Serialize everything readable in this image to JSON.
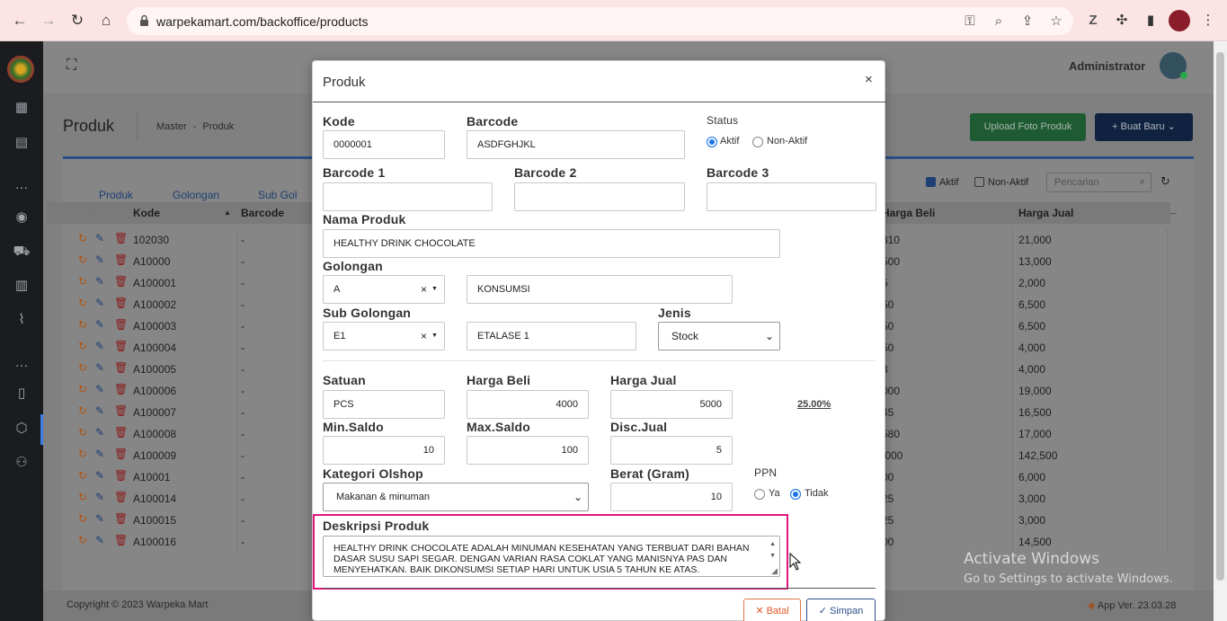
{
  "browser": {
    "url": "warpekamart.com/backoffice/products"
  },
  "topbar": {
    "user": "Administrator"
  },
  "page": {
    "title": "Produk",
    "breadcrumb": [
      "Master",
      "Produk"
    ],
    "buttons": {
      "upload": "Upload Foto Produk",
      "create": "+ Buat Baru"
    },
    "tabs": [
      "Produk",
      "Golongan",
      "Sub Gol"
    ],
    "filters": {
      "aktif": "Aktif",
      "nonaktif": "Non-Aktif",
      "search_placeholder": "Pencarian"
    }
  },
  "table": {
    "headers": [
      "Kode",
      "Barcode",
      "Harga Beli",
      "Harga Jual"
    ],
    "rows": [
      {
        "kode": "102030",
        "barcode": "-",
        "beli": "310",
        "jual": "21,000"
      },
      {
        "kode": "A10000",
        "barcode": "-",
        "beli": "500",
        "jual": "13,000"
      },
      {
        "kode": "A100001",
        "barcode": "-",
        "beli": "5",
        "jual": "2,000"
      },
      {
        "kode": "A100002",
        "barcode": "-",
        "beli": "50",
        "jual": "6,500"
      },
      {
        "kode": "A100003",
        "barcode": "-",
        "beli": "50",
        "jual": "6,500"
      },
      {
        "kode": "A100004",
        "barcode": "-",
        "beli": "50",
        "jual": "4,000"
      },
      {
        "kode": "A100005",
        "barcode": "-",
        "beli": "3",
        "jual": "4,000"
      },
      {
        "kode": "A100006",
        "barcode": "-",
        "beli": "000",
        "jual": "19,000"
      },
      {
        "kode": "A100007",
        "barcode": "-",
        "beli": "45",
        "jual": "16,500"
      },
      {
        "kode": "A100008",
        "barcode": "-",
        "beli": "580",
        "jual": "17,000"
      },
      {
        "kode": "A100009",
        "barcode": "-",
        "beli": ",000",
        "jual": "142,500"
      },
      {
        "kode": "A10001",
        "barcode": "-",
        "beli": "00",
        "jual": "6,000"
      },
      {
        "kode": "A100014",
        "barcode": "-",
        "beli": "25",
        "jual": "3,000"
      },
      {
        "kode": "A100015",
        "barcode": "-",
        "beli": "25",
        "jual": "3,000"
      },
      {
        "kode": "A100016",
        "barcode": "-",
        "beli": "00",
        "jual": "14,500"
      }
    ]
  },
  "footer": {
    "copyright": "Copyright © 2023 Warpeka Mart",
    "version": "App Ver. 23.03.28"
  },
  "modal": {
    "title": "Produk",
    "close": "×",
    "kode": {
      "label": "Kode",
      "value": "0000001"
    },
    "barcode": {
      "label": "Barcode",
      "value": "ASDFGHJKL"
    },
    "status": {
      "label": "Status",
      "aktif": "Aktif",
      "nonaktif": "Non-Aktif",
      "selected": "Aktif"
    },
    "barcode1": {
      "label": "Barcode 1",
      "value": ""
    },
    "barcode2": {
      "label": "Barcode 2",
      "value": ""
    },
    "barcode3": {
      "label": "Barcode 3",
      "value": ""
    },
    "nama": {
      "label": "Nama Produk",
      "value": "HEALTHY DRINK CHOCOLATE"
    },
    "golongan": {
      "label": "Golongan",
      "code": "A",
      "name": "KONSUMSI"
    },
    "subgolongan": {
      "label": "Sub Golongan",
      "code": "E1",
      "name": "ETALASE 1"
    },
    "jenis": {
      "label": "Jenis",
      "value": "Stock"
    },
    "satuan": {
      "label": "Satuan",
      "value": "PCS"
    },
    "harga_beli": {
      "label": "Harga Beli",
      "value": "4000"
    },
    "harga_jual": {
      "label": "Harga Jual",
      "value": "5000"
    },
    "margin": "25.00%",
    "min_saldo": {
      "label": "Min.Saldo",
      "value": "10"
    },
    "max_saldo": {
      "label": "Max.Saldo",
      "value": "100"
    },
    "disc_jual": {
      "label": "Disc.Jual",
      "value": "5"
    },
    "kategori": {
      "label": "Kategori Olshop",
      "value": "Makanan & minuman"
    },
    "berat": {
      "label": "Berat (Gram)",
      "value": "10"
    },
    "ppn": {
      "label": "PPN",
      "ya": "Ya",
      "tidak": "Tidak",
      "selected": "Tidak"
    },
    "deskripsi": {
      "label": "Deskripsi Produk",
      "value": "HEALTHY DRINK CHOCOLATE ADALAH MINUMAN KESEHATAN YANG TERBUAT DARI BAHAN DASAR SUSU SAPI SEGAR. DENGAN VARIAN RASA COKLAT YANG MANISNYA PAS DAN MENYEHATKAN. BAIK DIKONSUMSI SETIAP HARI UNTUK USIA 5 TAHUN KE ATAS."
    },
    "buttons": {
      "batal": "✕ Batal",
      "simpan": "✓ Simpan"
    }
  },
  "watermark": {
    "title": "Activate Windows",
    "subtitle": "Go to Settings to activate Windows."
  },
  "colors": {
    "primary": "#2c4d8a",
    "upload": "#28a745",
    "highlight": "#e0147a",
    "danger": "#e05a2b"
  }
}
